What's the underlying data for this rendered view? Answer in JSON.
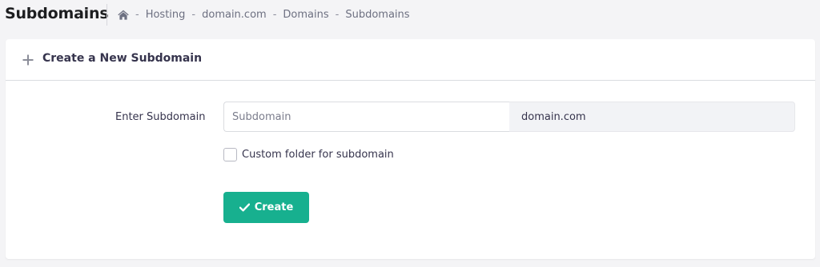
{
  "header": {
    "title": "Subdomains",
    "breadcrumb": {
      "home_icon": "home-icon",
      "separator": "-",
      "items": [
        "Hosting",
        "domain.com",
        "Domains",
        "Subdomains"
      ]
    }
  },
  "card": {
    "icon": "plus-icon",
    "title": "Create a New Subdomain"
  },
  "form": {
    "subdomain_label": "Enter Subdomain",
    "subdomain_placeholder": "Subdomain",
    "subdomain_value": "",
    "domain_suffix": "domain.com",
    "custom_folder_label": "Custom folder for subdomain",
    "custom_folder_checked": false,
    "create_button_label": "Create",
    "create_button_icon": "check-icon"
  },
  "colors": {
    "background": "#f4f4f6",
    "card": "#ffffff",
    "primary_button": "#17b08f",
    "text": "#36344d",
    "muted_text": "#6d7081"
  }
}
